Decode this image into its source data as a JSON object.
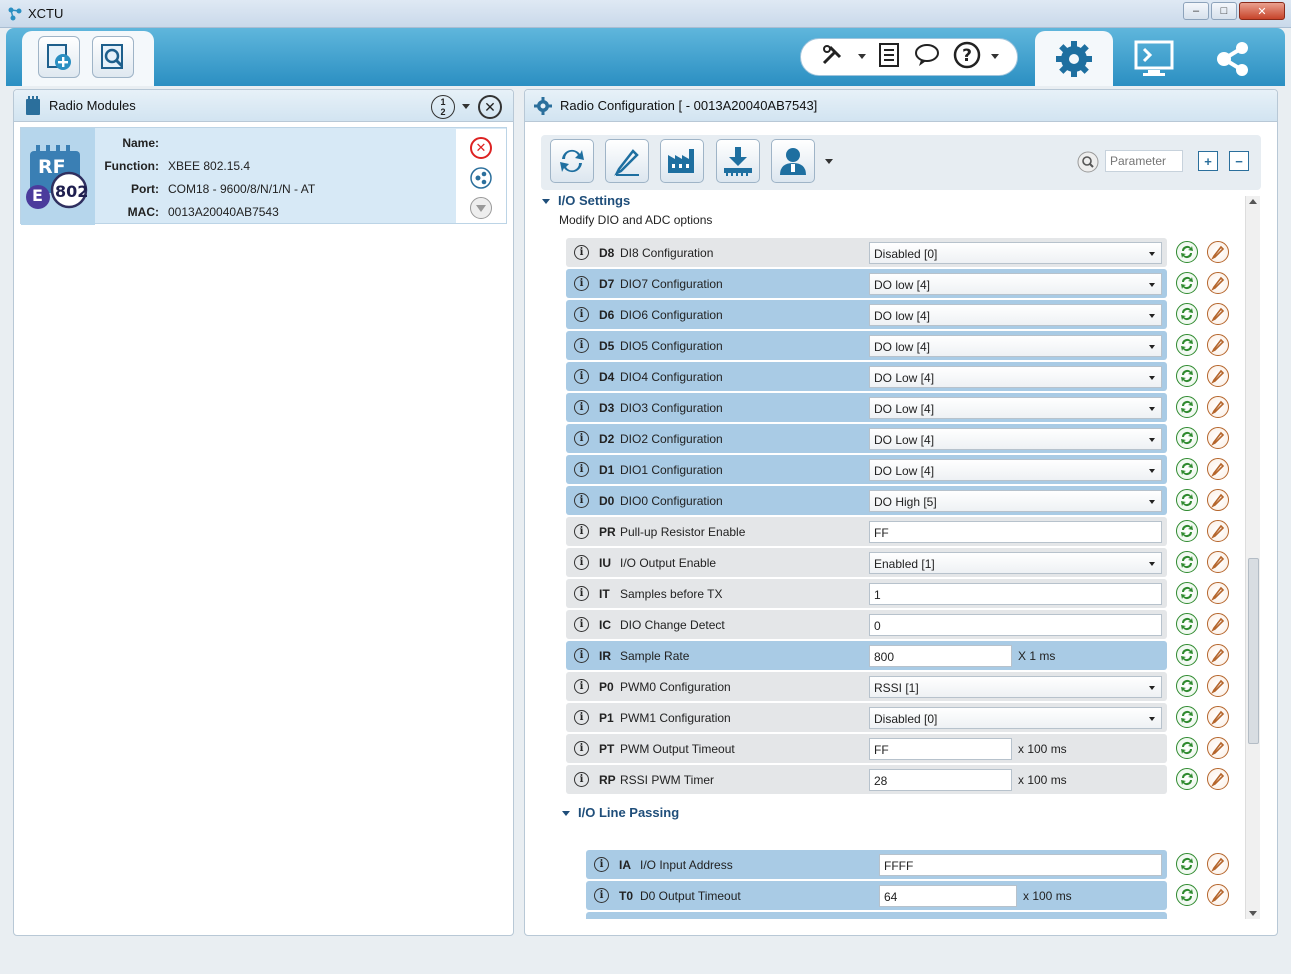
{
  "window": {
    "title": "XCTU"
  },
  "radio_modules": {
    "title": "Radio Modules",
    "module": {
      "rf_text": "RF",
      "badge_e": "E",
      "badge_802": "802",
      "fields": [
        {
          "key": "Name:",
          "value": ""
        },
        {
          "key": "Function:",
          "value": "XBEE 802.15.4"
        },
        {
          "key": "Port:",
          "value": "COM18 - 9600/8/N/1/N - AT"
        },
        {
          "key": "MAC:",
          "value": "0013A20040AB7543"
        }
      ]
    }
  },
  "radio_config": {
    "title": "Radio Configuration [  - 0013A20040AB7543]",
    "search_placeholder": "Parameter",
    "sections": [
      {
        "title": "I/O Settings",
        "subtitle": "Modify DIO and ADC options"
      },
      {
        "title": "I/O Line Passing"
      }
    ],
    "rows": [
      {
        "code": "D8",
        "label": "DI8 Configuration",
        "value": "Disabled [0]",
        "type": "select",
        "hl": false
      },
      {
        "code": "D7",
        "label": "DIO7 Configuration",
        "value": "DO low [4]",
        "type": "select",
        "hl": true
      },
      {
        "code": "D6",
        "label": "DIO6 Configuration",
        "value": "DO low [4]",
        "type": "select",
        "hl": true
      },
      {
        "code": "D5",
        "label": "DIO5 Configuration",
        "value": "DO low [4]",
        "type": "select",
        "hl": true
      },
      {
        "code": "D4",
        "label": "DIO4 Configuration",
        "value": "DO Low [4]",
        "type": "select",
        "hl": true
      },
      {
        "code": "D3",
        "label": "DIO3 Configuration",
        "value": "DO Low [4]",
        "type": "select",
        "hl": true
      },
      {
        "code": "D2",
        "label": "DIO2 Configuration",
        "value": "DO Low [4]",
        "type": "select",
        "hl": true
      },
      {
        "code": "D1",
        "label": "DIO1 Configuration",
        "value": "DO Low [4]",
        "type": "select",
        "hl": true
      },
      {
        "code": "D0",
        "label": "DIO0 Configuration",
        "value": "DO High [5]",
        "type": "select",
        "hl": true
      },
      {
        "code": "PR",
        "label": "Pull-up Resistor Enable",
        "value": "FF",
        "type": "text",
        "hl": false
      },
      {
        "code": "IU",
        "label": "I/O Output Enable",
        "value": "Enabled [1]",
        "type": "select",
        "hl": false
      },
      {
        "code": "IT",
        "label": "Samples before TX",
        "value": "1",
        "type": "text",
        "hl": false
      },
      {
        "code": "IC",
        "label": "DIO Change Detect",
        "value": "0",
        "type": "text",
        "hl": false
      },
      {
        "code": "IR",
        "label": "Sample Rate",
        "value": "800",
        "type": "text",
        "unit": "X 1 ms",
        "hl": true
      },
      {
        "code": "P0",
        "label": "PWM0 Configuration",
        "value": "RSSI [1]",
        "type": "select",
        "hl": false
      },
      {
        "code": "P1",
        "label": "PWM1 Configuration",
        "value": "Disabled [0]",
        "type": "select",
        "hl": false
      },
      {
        "code": "PT",
        "label": "PWM Output Timeout",
        "value": "FF",
        "type": "text",
        "unit": "x 100 ms",
        "hl": false
      },
      {
        "code": "RP",
        "label": "RSSI PWM Timer",
        "value": "28",
        "type": "text",
        "unit": "x 100 ms",
        "hl": false
      }
    ],
    "rows2": [
      {
        "code": "IA",
        "label": "I/O Input Address",
        "value": "FFFF",
        "type": "text",
        "hl": true
      },
      {
        "code": "T0",
        "label": "D0 Output Timeout",
        "value": "64",
        "type": "text",
        "unit": "x 100 ms",
        "hl": true
      }
    ]
  },
  "colors": {
    "accent": "#2b8fc2",
    "row_highlight": "#a9cbe5",
    "row_normal": "#e4e6e8",
    "read": "#2f8a2f",
    "write": "#b5652b"
  }
}
